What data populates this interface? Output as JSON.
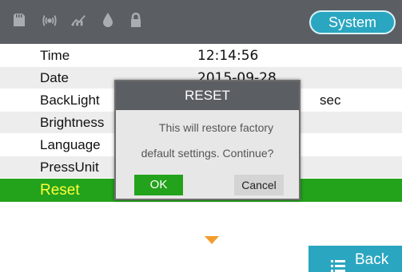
{
  "statusbar": {
    "icons": [
      "sd-card-icon",
      "signal-icon",
      "trend-icon",
      "drop-icon",
      "lock-icon"
    ],
    "system_label": "System"
  },
  "settings": {
    "rows": [
      {
        "label": "Time",
        "value": "12:14:56",
        "unit": ""
      },
      {
        "label": "Date",
        "value": "2015-09-28",
        "unit": ""
      },
      {
        "label": "BackLight",
        "value": "",
        "unit": "sec"
      },
      {
        "label": "Brightness",
        "value": "",
        "unit": ""
      },
      {
        "label": "Language",
        "value": "",
        "unit": ""
      },
      {
        "label": "PressUnit",
        "value": "",
        "unit": ""
      },
      {
        "label": "Reset",
        "value": "",
        "unit": ""
      }
    ]
  },
  "dialog": {
    "title": "RESET",
    "message_line1": "This will restore factory",
    "message_line2": "default settings. Continue?",
    "ok_label": "OK",
    "cancel_label": "Cancel"
  },
  "footer": {
    "back_label": "Back"
  },
  "colors": {
    "header_bg": "#5b5f63",
    "accent_blue": "#2aa6c0",
    "selected_green": "#23a21c",
    "selected_text": "#ffff3a",
    "arrow_orange": "#f29d2c"
  }
}
